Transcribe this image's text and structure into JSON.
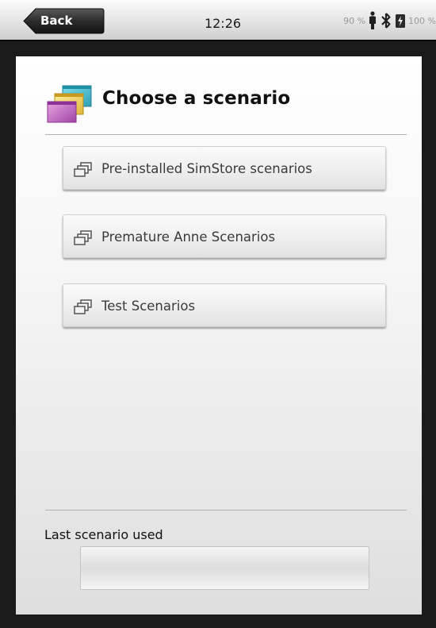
{
  "status_bar": {
    "back_label": "Back",
    "time": "12:26",
    "battery_left": "90 %",
    "battery_right": "100 %",
    "icons": [
      "person-icon",
      "bluetooth-icon",
      "battery-charging-icon"
    ]
  },
  "header": {
    "title": "Choose a scenario",
    "icon": "stacked-windows-icon"
  },
  "scenarios": [
    {
      "label": "Pre-installed SimStore scenarios",
      "icon": "stacked-windows-icon"
    },
    {
      "label": "Premature Anne Scenarios",
      "icon": "stacked-windows-icon"
    },
    {
      "label": "Test Scenarios",
      "icon": "stacked-windows-icon"
    }
  ],
  "last_scenario": {
    "label": "Last scenario used",
    "value": ""
  },
  "colors": {
    "back_button": "#2b2b2b",
    "panel_top": "#ffffff",
    "panel_bottom": "#dedede",
    "divider": "#b9b1ad"
  }
}
